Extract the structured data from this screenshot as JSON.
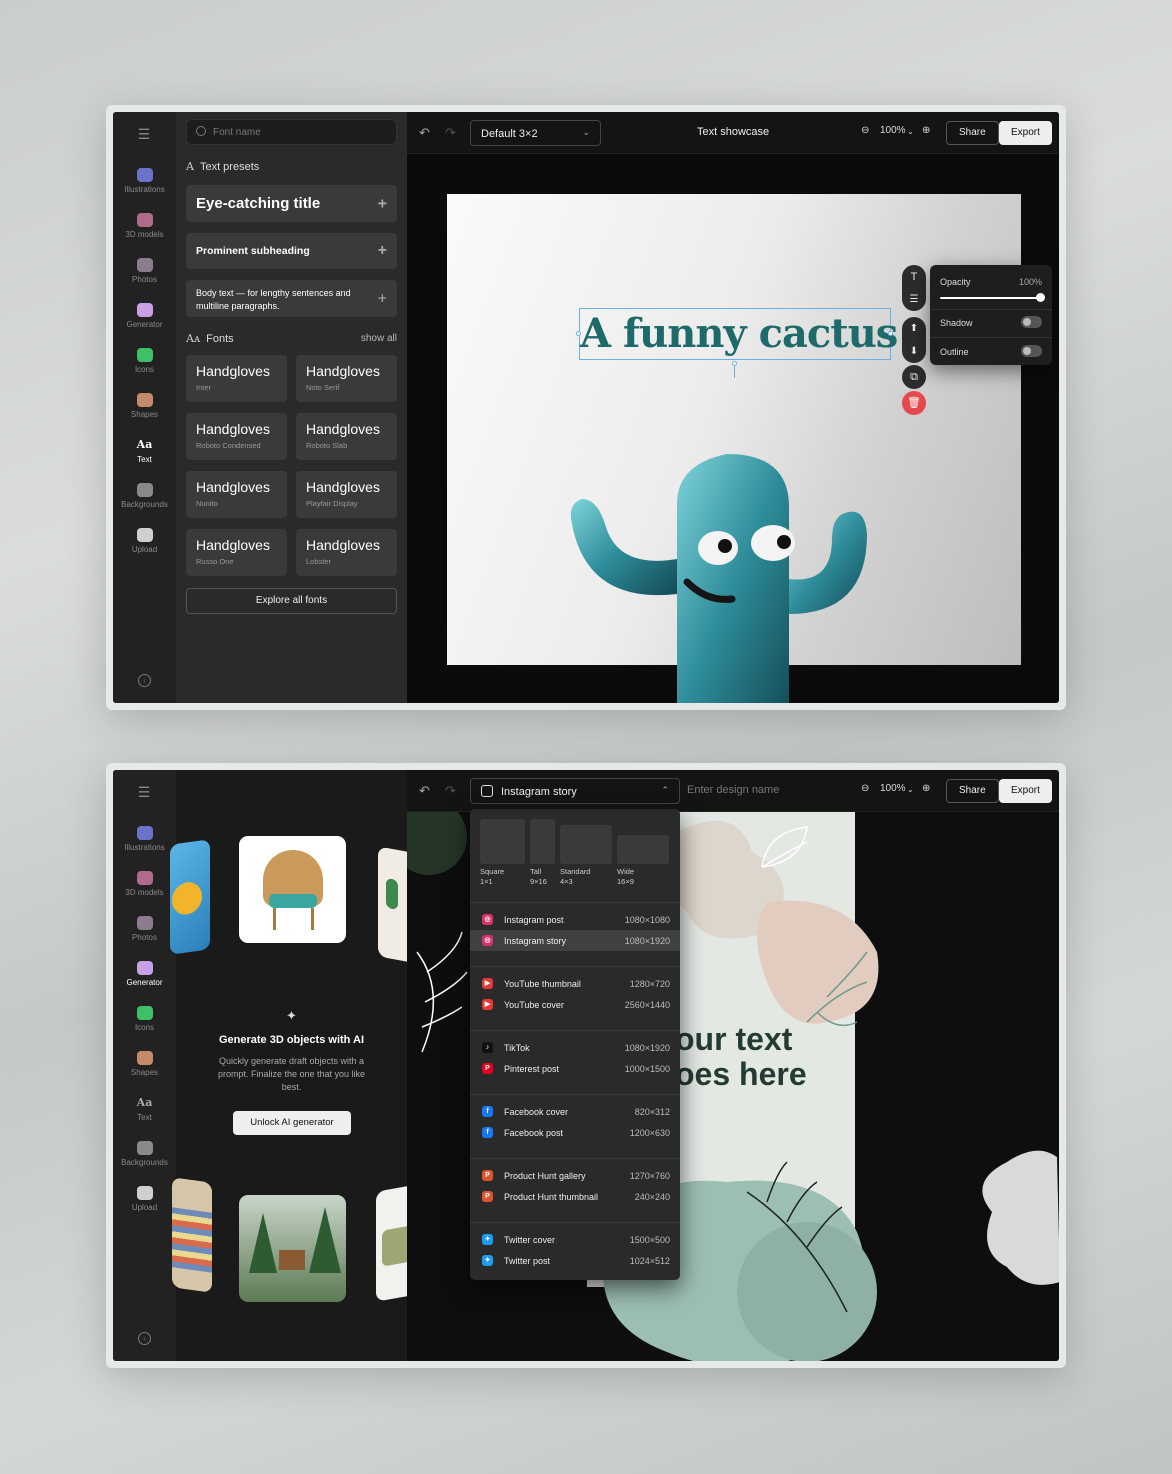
{
  "top": {
    "rail": {
      "items": [
        {
          "label": "Illustrations",
          "icon": "illustrations-icon",
          "color": "#6b72c9"
        },
        {
          "label": "3D models",
          "icon": "cube-icon",
          "color": "#b06b8c"
        },
        {
          "label": "Photos",
          "icon": "photo-icon",
          "color": "#8c7a8f"
        },
        {
          "label": "Generator",
          "icon": "sparkle-icon",
          "color": "#c9a0e6"
        },
        {
          "label": "Icons",
          "icon": "icons-icon",
          "color": "#3fbf6a"
        },
        {
          "label": "Shapes",
          "icon": "shapes-icon",
          "color": "#c48a6a"
        },
        {
          "label": "Text",
          "icon": "text-icon",
          "glyph": "Aa",
          "active": true
        },
        {
          "label": "Backgrounds",
          "icon": "backgrounds-icon",
          "color": "#8a8a8a"
        },
        {
          "label": "Upload",
          "icon": "upload-icon",
          "color": "#cfcfcf"
        }
      ]
    },
    "panel": {
      "search_placeholder": "Font name",
      "presets_heading": "Text presets",
      "presets": [
        {
          "label": "Eye-catching title"
        },
        {
          "label": "Prominent subheading"
        },
        {
          "label": "Body text — for lengthy sentences and multiline paragraphs."
        }
      ],
      "fonts_heading": "Fonts",
      "show_all": "show all",
      "fonts": [
        {
          "sample": "Handgloves",
          "name": "Inter"
        },
        {
          "sample": "Handgloves",
          "name": "Noto Serif"
        },
        {
          "sample": "Handgloves",
          "name": "Roboto Condensed"
        },
        {
          "sample": "Handgloves",
          "name": "Roboto Slab"
        },
        {
          "sample": "Handgloves",
          "name": "Nunito"
        },
        {
          "sample": "Handgloves",
          "name": "Playfair Display"
        },
        {
          "sample": "Handgloves",
          "name": "Russo One"
        },
        {
          "sample": "Handgloves",
          "name": "Lobster"
        }
      ],
      "explore": "Explore all fonts"
    },
    "topbar": {
      "size_select": "Default 3×2",
      "doc_title": "Text showcase",
      "zoom": "100%",
      "share": "Share",
      "export": "Export"
    },
    "canvas": {
      "headline": "A funny cactus",
      "popover": {
        "opacity_label": "Opacity",
        "opacity_value": "100%",
        "shadow_label": "Shadow",
        "outline_label": "Outline"
      }
    }
  },
  "bottom": {
    "rail": {
      "items": [
        {
          "label": "Illustrations",
          "icon": "illustrations-icon",
          "color": "#6b72c9"
        },
        {
          "label": "3D models",
          "icon": "cube-icon",
          "color": "#b06b8c"
        },
        {
          "label": "Photos",
          "icon": "photo-icon",
          "color": "#8c7a8f"
        },
        {
          "label": "Generator",
          "icon": "sparkle-icon",
          "color": "#c9a0e6",
          "active": true
        },
        {
          "label": "Icons",
          "icon": "icons-icon",
          "color": "#3fbf6a"
        },
        {
          "label": "Shapes",
          "icon": "shapes-icon",
          "color": "#c48a6a"
        },
        {
          "label": "Text",
          "icon": "text-icon",
          "glyph": "Aa"
        },
        {
          "label": "Backgrounds",
          "icon": "backgrounds-icon",
          "color": "#8a8a8a"
        },
        {
          "label": "Upload",
          "icon": "upload-icon",
          "color": "#cfcfcf"
        }
      ]
    },
    "generator": {
      "title": "Generate 3D objects with AI",
      "subtitle": "Quickly generate draft objects with a prompt. Finalize the one that you like best.",
      "button": "Unlock AI generator"
    },
    "topbar": {
      "size_select": "Instagram story",
      "name_placeholder": "Enter design name",
      "zoom": "100%",
      "share": "Share",
      "export": "Export"
    },
    "dropdown": {
      "formats": [
        {
          "label": "Square",
          "ratio": "1×1"
        },
        {
          "label": "Tall",
          "ratio": "9×16"
        },
        {
          "label": "Standard",
          "ratio": "4×3"
        },
        {
          "label": "Wide",
          "ratio": "16×9"
        }
      ],
      "items": [
        {
          "label": "Instagram post",
          "size": "1080×1080",
          "icon": "instagram-icon",
          "color": "#d6336c"
        },
        {
          "label": "Instagram story",
          "size": "1080×1920",
          "icon": "instagram-icon",
          "color": "#d6336c",
          "selected": true
        },
        {
          "label": "YouTube thumbnail",
          "size": "1280×720",
          "icon": "youtube-icon",
          "color": "#e53935"
        },
        {
          "label": "YouTube cover",
          "size": "2560×1440",
          "icon": "youtube-icon",
          "color": "#e53935"
        },
        {
          "label": "TikTok",
          "size": "1080×1920",
          "icon": "tiktok-icon",
          "color": "#111111"
        },
        {
          "label": "Pinterest post",
          "size": "1000×1500",
          "icon": "pinterest-icon",
          "color": "#e60023"
        },
        {
          "label": "Facebook cover",
          "size": "820×312",
          "icon": "facebook-icon",
          "color": "#1877f2"
        },
        {
          "label": "Facebook post",
          "size": "1200×630",
          "icon": "facebook-icon",
          "color": "#1877f2"
        },
        {
          "label": "Product Hunt gallery",
          "size": "1270×760",
          "icon": "producthunt-icon",
          "color": "#da552f"
        },
        {
          "label": "Product Hunt thumbnail",
          "size": "240×240",
          "icon": "producthunt-icon",
          "color": "#da552f"
        },
        {
          "label": "Twitter cover",
          "size": "1500×500",
          "icon": "twitter-icon",
          "color": "#1d9bf0"
        },
        {
          "label": "Twitter post",
          "size": "1024×512",
          "icon": "twitter-icon",
          "color": "#1d9bf0"
        }
      ]
    },
    "canvas": {
      "headline_line1": "our text",
      "headline_line2": "oes here"
    }
  }
}
